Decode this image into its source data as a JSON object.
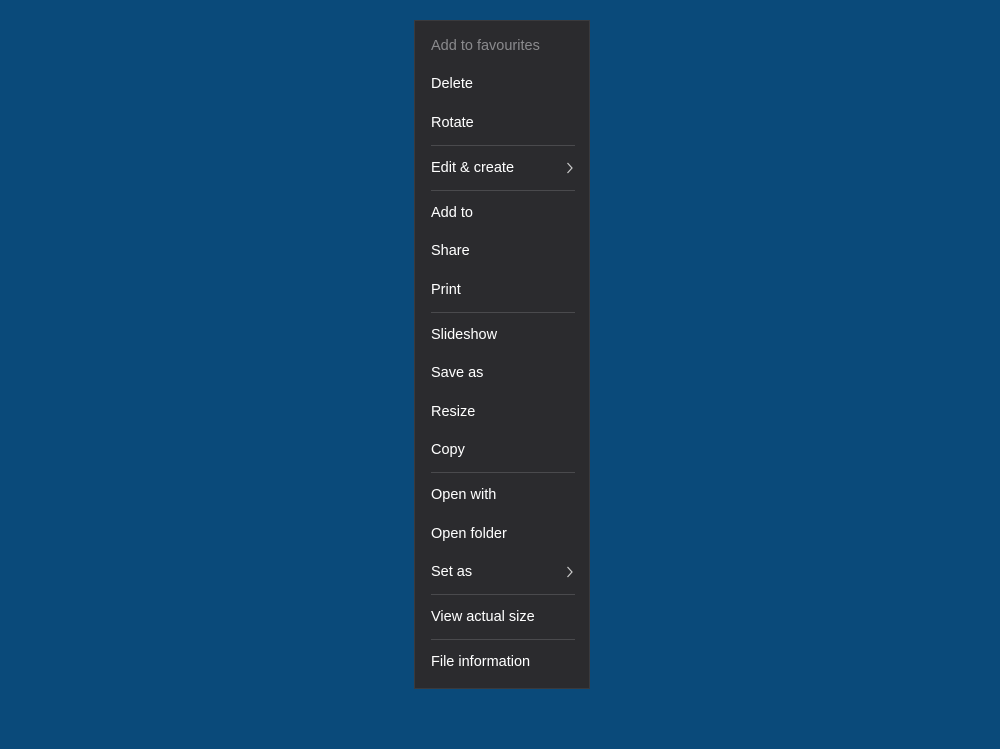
{
  "menu": {
    "add_favourites": "Add to favourites",
    "delete": "Delete",
    "rotate": "Rotate",
    "edit_create": "Edit & create",
    "add_to": "Add to",
    "share": "Share",
    "print": "Print",
    "slideshow": "Slideshow",
    "save_as": "Save as",
    "resize": "Resize",
    "copy": "Copy",
    "open_with": "Open with",
    "open_folder": "Open folder",
    "set_as": "Set as",
    "view_actual_size": "View actual size",
    "file_information": "File information"
  }
}
